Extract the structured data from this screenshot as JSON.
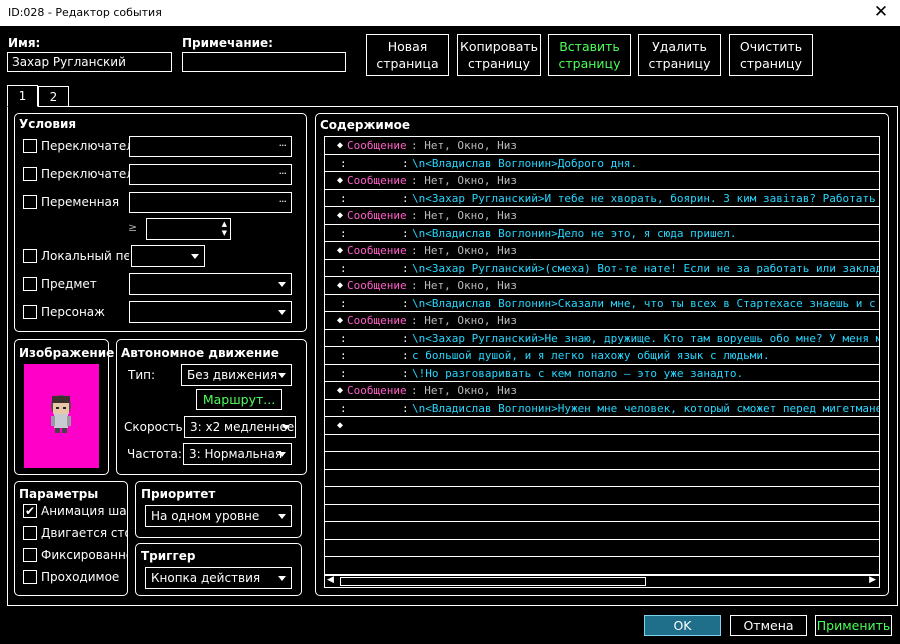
{
  "window": {
    "title": "ID:028 - Редактор события",
    "close_glyph": "✕"
  },
  "header": {
    "name_label": "Имя:",
    "name_value": "Захар Ругланский",
    "note_label": "Примечание:",
    "note_value": ""
  },
  "toolbar": {
    "new_page": [
      "Новая",
      "страница"
    ],
    "copy_page": [
      "Копировать",
      "страницу"
    ],
    "paste_page": [
      "Вставить",
      "страницу"
    ],
    "delete_page": [
      "Удалить",
      "страницу"
    ],
    "clear_page": [
      "Очистить",
      "страницу"
    ]
  },
  "tabs": [
    "1",
    "2"
  ],
  "conditions": {
    "title": "Условия",
    "switch1_label": "Переключатель",
    "switch2_label": "Переключатель",
    "variable_label": "Переменная",
    "ge_symbol": "≥",
    "self_switch_label": "Локальный переключатель",
    "item_label": "Предмет",
    "actor_label": "Персонаж",
    "dots": "···"
  },
  "image": {
    "title": "Изображение"
  },
  "autonomous": {
    "title": "Автономное движение",
    "type_label": "Тип:",
    "type_value": "Без движения",
    "route_button": "Маршрут...",
    "speed_label": "Скорость:",
    "speed_value": "3: x2 медленнее",
    "freq_label": "Частота:",
    "freq_value": "3: Нормальная"
  },
  "options": {
    "title": "Параметры",
    "items": [
      {
        "label": "Анимация шага",
        "checked": true,
        "mark": "✔"
      },
      {
        "label": "Двигается стоя",
        "checked": false,
        "mark": ""
      },
      {
        "label": "Фиксированное направление",
        "checked": false,
        "mark": ""
      },
      {
        "label": "Проходимое",
        "checked": false,
        "mark": ""
      }
    ]
  },
  "priority": {
    "title": "Приоритет",
    "value": "На одном уровне"
  },
  "trigger": {
    "title": "Триггер",
    "value": "Кнопка действия"
  },
  "contents": {
    "title": "Содержимое",
    "rows": [
      {
        "kind": "cmd",
        "dia": "◆",
        "cmd": "Сообщение",
        "args": ": Нет, Окно, Низ"
      },
      {
        "kind": "text",
        "c1": ":",
        "c2": ":",
        "text": "\\n<Владислав Воглонин>Доброго дня."
      },
      {
        "kind": "cmd",
        "dia": "◆",
        "cmd": "Сообщение",
        "args": ": Нет, Окно, Низ"
      },
      {
        "kind": "text",
        "c1": ":",
        "c2": ":",
        "text": "\\n<Захар Ругланский>И тебе не хворать, боярин. З ким завітав? Работать желаешь"
      },
      {
        "kind": "cmd",
        "dia": "◆",
        "cmd": "Сообщение",
        "args": ": Нет, Окно, Низ"
      },
      {
        "kind": "text",
        "c1": ":",
        "c2": ":",
        "text": "\\n<Владислав Воглонин>Дело не это, я сюда пришел."
      },
      {
        "kind": "cmd",
        "dia": "◆",
        "cmd": "Сообщение",
        "args": ": Нет, Окно, Низ"
      },
      {
        "kind": "text",
        "c1": ":",
        "c2": ":",
        "text": "\\n<Захар Ругланский>(смеха) Вот-те нате! Если не за работать или закладом, что"
      },
      {
        "kind": "cmd",
        "dia": "◆",
        "cmd": "Сообщение",
        "args": ": Нет, Окно, Низ"
      },
      {
        "kind": "text",
        "c1": ":",
        "c2": ":",
        "text": "\\n<Владислав Воглонин>Сказали мне, что ты всех в Стартехасе знаешь и с кем угод"
      },
      {
        "kind": "cmd",
        "dia": "◆",
        "cmd": "Сообщение",
        "args": ": Нет, Окно, Низ"
      },
      {
        "kind": "text",
        "c1": ":",
        "c2": ":",
        "text": "\\n<Захар Ругланский>Не знаю, дружище. Кто там воруешь обо мне? У меня много дру"
      },
      {
        "kind": "text",
        "c1": ":",
        "c2": ":",
        "text": "с большой душой, и я легко нахожу общий язык с людьми."
      },
      {
        "kind": "text",
        "c1": ":",
        "c2": ":",
        "text": "\\!Но разговаривать с кем попало — это уже занадто."
      },
      {
        "kind": "cmd",
        "dia": "◆",
        "cmd": "Сообщение",
        "args": ": Нет, Окно, Низ"
      },
      {
        "kind": "text",
        "c1": ":",
        "c2": ":",
        "text": "\\n<Владислав Воглонин>Нужен мне человек, который сможет перед мигетманем Горель"
      },
      {
        "kind": "end",
        "dia": "◆"
      }
    ],
    "scroll_left": "◀",
    "scroll_right": "▶"
  },
  "footer": {
    "ok": "OK",
    "cancel": "Отмена",
    "apply": "Применить"
  },
  "colors": {
    "accent_ok": "#1f6f8b",
    "green": "#4cff5a",
    "pink": "#ff5fc8",
    "cyan": "#27d7ff"
  }
}
